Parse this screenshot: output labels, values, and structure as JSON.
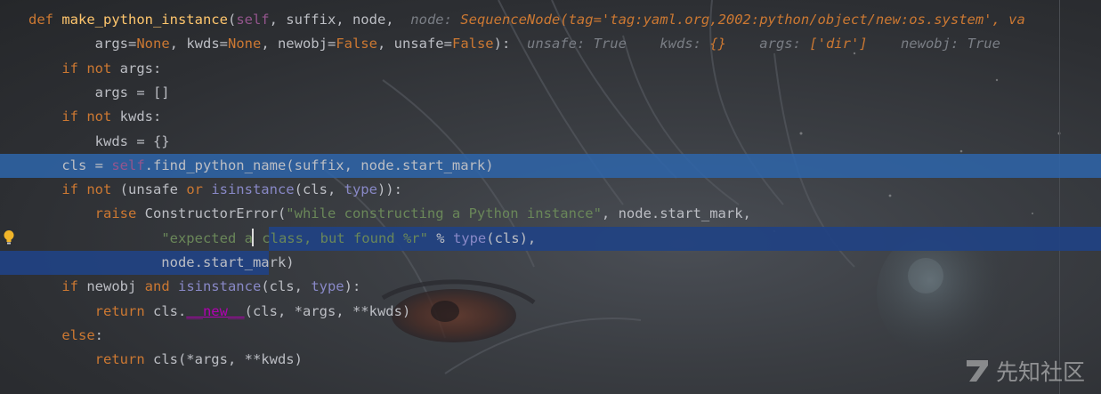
{
  "editor": {
    "lines": [
      {
        "id": "l1",
        "tokens": [
          {
            "t": "def ",
            "c": "kw"
          },
          {
            "t": "make_python_instance",
            "c": "fn"
          },
          {
            "t": "(",
            "c": ""
          },
          {
            "t": "self",
            "c": "self"
          },
          {
            "t": ", suffix, node,  ",
            "c": ""
          },
          {
            "t": "node: ",
            "c": "hint"
          },
          {
            "t": "SequenceNode(tag='tag:yaml.org,2002:python/object/new:os.system', va",
            "c": "hintv"
          }
        ]
      },
      {
        "id": "l2",
        "tokens": [
          {
            "t": "        args=",
            "c": ""
          },
          {
            "t": "None",
            "c": "kw"
          },
          {
            "t": ", kwds=",
            "c": ""
          },
          {
            "t": "None",
            "c": "kw"
          },
          {
            "t": ", newobj=",
            "c": ""
          },
          {
            "t": "False",
            "c": "kw"
          },
          {
            "t": ", unsafe=",
            "c": ""
          },
          {
            "t": "False",
            "c": "kw"
          },
          {
            "t": "):  ",
            "c": ""
          },
          {
            "t": "unsafe: True    kwds: ",
            "c": "hint"
          },
          {
            "t": "{}",
            "c": "hintv"
          },
          {
            "t": "    args: ",
            "c": "hint"
          },
          {
            "t": "['dir']",
            "c": "hintv"
          },
          {
            "t": "    newobj: True",
            "c": "hint"
          }
        ]
      },
      {
        "id": "l3",
        "tokens": [
          {
            "t": "    ",
            "c": ""
          },
          {
            "t": "if not ",
            "c": "kw"
          },
          {
            "t": "args:",
            "c": ""
          }
        ]
      },
      {
        "id": "l4",
        "tokens": [
          {
            "t": "        args = []",
            "c": ""
          }
        ]
      },
      {
        "id": "l5",
        "tokens": [
          {
            "t": "    ",
            "c": ""
          },
          {
            "t": "if not ",
            "c": "kw"
          },
          {
            "t": "kwds:",
            "c": ""
          }
        ]
      },
      {
        "id": "l6",
        "tokens": [
          {
            "t": "        kwds = {}",
            "c": ""
          }
        ]
      },
      {
        "id": "l7",
        "tokens": [
          {
            "t": "    cls = ",
            "c": ""
          },
          {
            "t": "self",
            "c": "self"
          },
          {
            "t": ".find_python_name(suffix, node.start_mark)",
            "c": ""
          }
        ]
      },
      {
        "id": "l8",
        "tokens": [
          {
            "t": "    ",
            "c": ""
          },
          {
            "t": "if not ",
            "c": "kw"
          },
          {
            "t": "(unsafe ",
            "c": ""
          },
          {
            "t": "or ",
            "c": "kw"
          },
          {
            "t": "isinstance",
            "c": "builtin"
          },
          {
            "t": "(cls, ",
            "c": ""
          },
          {
            "t": "type",
            "c": "builtin"
          },
          {
            "t": ")):",
            "c": ""
          }
        ]
      },
      {
        "id": "l9",
        "tokens": [
          {
            "t": "        ",
            "c": ""
          },
          {
            "t": "raise ",
            "c": "kw"
          },
          {
            "t": "ConstructorError(",
            "c": ""
          },
          {
            "t": "\"while constructing a Python instance\"",
            "c": "str"
          },
          {
            "t": ", node.start_mark,",
            "c": ""
          }
        ]
      },
      {
        "id": "l10",
        "tokens": [
          {
            "t": "                ",
            "c": ""
          },
          {
            "t": "\"expected a",
            "c": "str"
          },
          {
            "t": "",
            "c": "caret"
          },
          {
            "t": " class, but found %r\"",
            "c": "str"
          },
          {
            "t": " % ",
            "c": ""
          },
          {
            "t": "type",
            "c": "builtin"
          },
          {
            "t": "(cls),",
            "c": ""
          }
        ]
      },
      {
        "id": "l11",
        "tokens": [
          {
            "t": "                node.start_mark)",
            "c": ""
          }
        ]
      },
      {
        "id": "l12",
        "tokens": [
          {
            "t": "    ",
            "c": ""
          },
          {
            "t": "if ",
            "c": "kw"
          },
          {
            "t": "newobj ",
            "c": ""
          },
          {
            "t": "and ",
            "c": "kw"
          },
          {
            "t": "isinstance",
            "c": "builtin"
          },
          {
            "t": "(cls, ",
            "c": ""
          },
          {
            "t": "type",
            "c": "builtin"
          },
          {
            "t": "):",
            "c": ""
          }
        ]
      },
      {
        "id": "l13",
        "tokens": [
          {
            "t": "        ",
            "c": ""
          },
          {
            "t": "return ",
            "c": "kw"
          },
          {
            "t": "cls.",
            "c": ""
          },
          {
            "t": "__new__",
            "c": "dunder"
          },
          {
            "t": "(cls, *args, **kwds)",
            "c": ""
          }
        ]
      },
      {
        "id": "l14",
        "tokens": [
          {
            "t": "    ",
            "c": ""
          },
          {
            "t": "else",
            "c": "kw"
          },
          {
            "t": ":",
            "c": ""
          }
        ]
      },
      {
        "id": "l15",
        "tokens": [
          {
            "t": "        ",
            "c": ""
          },
          {
            "t": "return ",
            "c": "kw"
          },
          {
            "t": "cls(*args, **kwds)",
            "c": ""
          }
        ]
      }
    ],
    "current_line": 7,
    "selection_lines": [
      10,
      11
    ]
  },
  "icons": {
    "gutter": "lightbulb-icon",
    "watermark": "xianzhi-logo-icon"
  },
  "watermark": {
    "text": "先知社区"
  },
  "colors": {
    "keyword": "#cc7832",
    "function": "#ffc66d",
    "self": "#94558d",
    "builtin": "#8888c6",
    "string": "#6a8759",
    "hint": "#7a7e85",
    "current_line": "#2e65aa",
    "selection": "#214283"
  }
}
